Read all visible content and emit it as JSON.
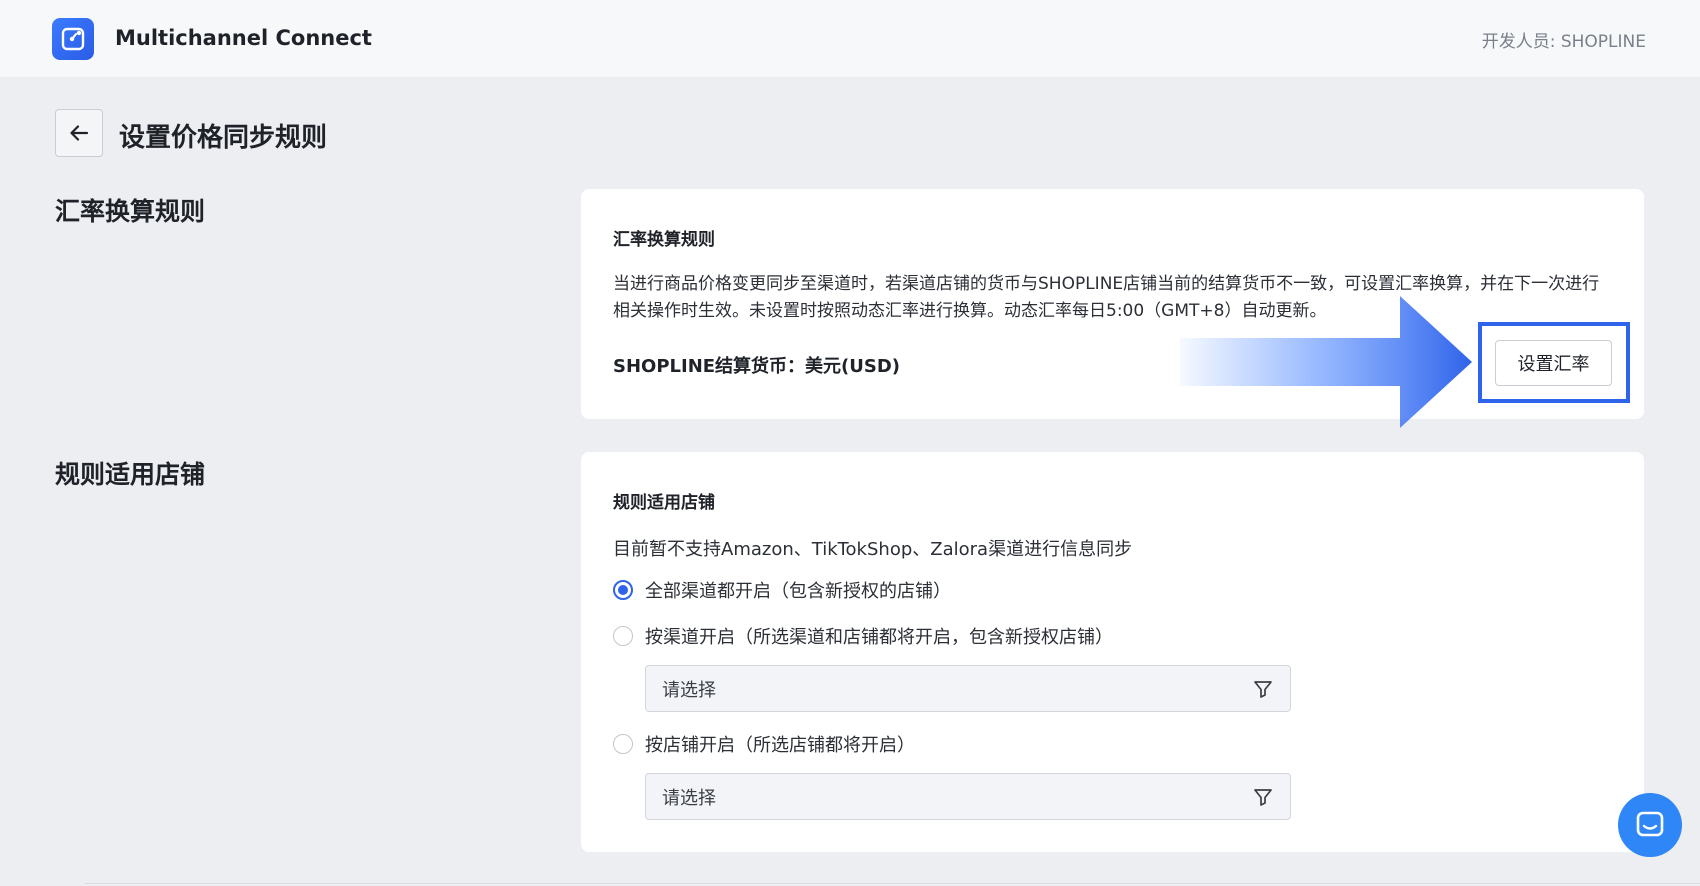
{
  "header": {
    "app_name": "Multichannel Connect",
    "developer": "开发人员: SHOPLINE"
  },
  "page": {
    "title": "设置价格同步规则"
  },
  "exchange_section": {
    "label": "汇率换算规则",
    "card_title": "汇率换算规则",
    "description": "当进行商品价格变更同步至渠道时，若渠道店铺的货币与SHOPLINE店铺当前的结算货币不一致，可设置汇率换算，并在下一次进行相关操作时生效。未设置时按照动态汇率进行换算。动态汇率每日5:00（GMT+8）自动更新。",
    "currency": "SHOPLINE结算货币：美元(USD)",
    "set_rate_button": "设置汇率"
  },
  "stores_section": {
    "label": "规则适用店铺",
    "card_title": "规则适用店铺",
    "note": "目前暂不支持Amazon、TikTokShop、Zalora渠道进行信息同步",
    "options": [
      {
        "label": "全部渠道都开启（包含新授权的店铺）",
        "checked": true
      },
      {
        "label": "按渠道开启（所选渠道和店铺都将开启，包含新授权店铺）",
        "checked": false
      },
      {
        "label": "按店铺开启（所选店铺都将开启）",
        "checked": false
      }
    ],
    "select_placeholder": "请选择"
  },
  "colors": {
    "accent": "#2f63ea",
    "background": "#eceef2",
    "chat": "#2f86f6"
  },
  "icons": {
    "logo": "app-logo-icon",
    "back": "arrow-left-icon",
    "filter": "filter-icon",
    "chat": "chat-bubble-icon"
  }
}
